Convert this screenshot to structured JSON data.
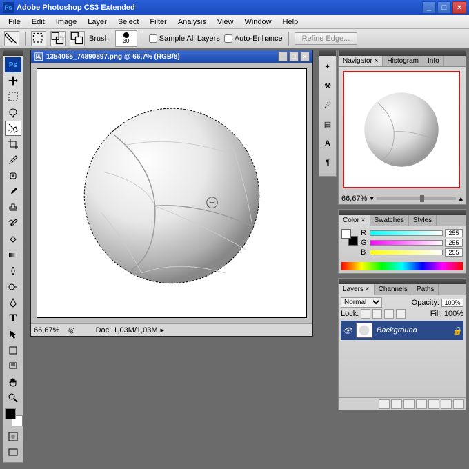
{
  "app": {
    "title": "Adobe Photoshop CS3 Extended"
  },
  "menu": [
    "File",
    "Edit",
    "Image",
    "Layer",
    "Select",
    "Filter",
    "Analysis",
    "View",
    "Window",
    "Help"
  ],
  "options": {
    "brush_label": "Brush:",
    "brush_size": "30",
    "sample_all": "Sample All Layers",
    "auto_enhance": "Auto-Enhance",
    "refine_edge": "Refine Edge..."
  },
  "doc": {
    "title": "1354065_74890897.png @ 66,7% (RGB/8)",
    "zoom": "66,67%",
    "info": "Doc: 1,03M/1,03M"
  },
  "nav": {
    "tabs": [
      "Navigator ×",
      "Histogram",
      "Info"
    ],
    "zoom": "66,67%"
  },
  "color": {
    "tabs": [
      "Color ×",
      "Swatches",
      "Styles"
    ],
    "r": {
      "lbl": "R",
      "val": "255"
    },
    "g": {
      "lbl": "G",
      "val": "255"
    },
    "b": {
      "lbl": "B",
      "val": "255"
    }
  },
  "layers": {
    "tabs": [
      "Layers ×",
      "Channels",
      "Paths"
    ],
    "blend": "Normal",
    "opacity_lbl": "Opacity:",
    "opacity": "100%",
    "lock_lbl": "Lock:",
    "fill_lbl": "Fill:",
    "fill": "100%",
    "bg_layer": "Background"
  }
}
